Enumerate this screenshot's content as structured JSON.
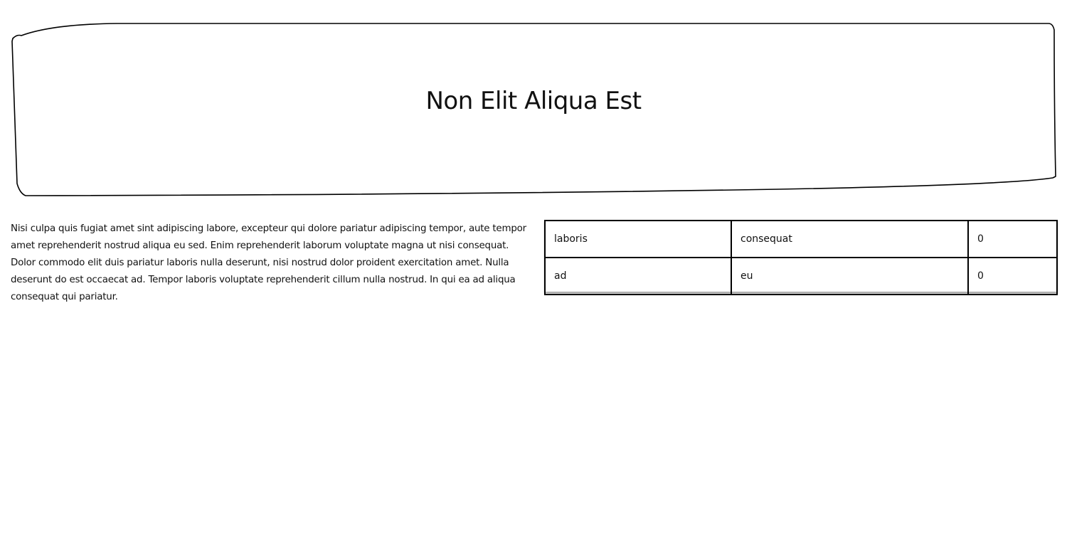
{
  "header": {
    "title": "Non Elit Aliqua Est"
  },
  "main": {
    "paragraph": "Nisi culpa quis fugiat amet sint adipiscing labore, excepteur qui dolore pariatur adipiscing tempor, aute tempor amet reprehenderit nostrud aliqua eu sed. Enim reprehenderit laborum voluptate magna ut nisi consequat. Dolor commodo elit duis pariatur laboris nulla deserunt, nisi nostrud dolor proident exercitation amet. Nulla deserunt do est occaecat ad. Tempor laboris voluptate reprehenderit cillum nulla nostrud. In qui ea ad aliqua consequat qui pariatur."
  },
  "table": {
    "rows": [
      [
        "laboris",
        "consequat",
        "0"
      ],
      [
        "ad",
        "eu",
        "0"
      ]
    ]
  }
}
